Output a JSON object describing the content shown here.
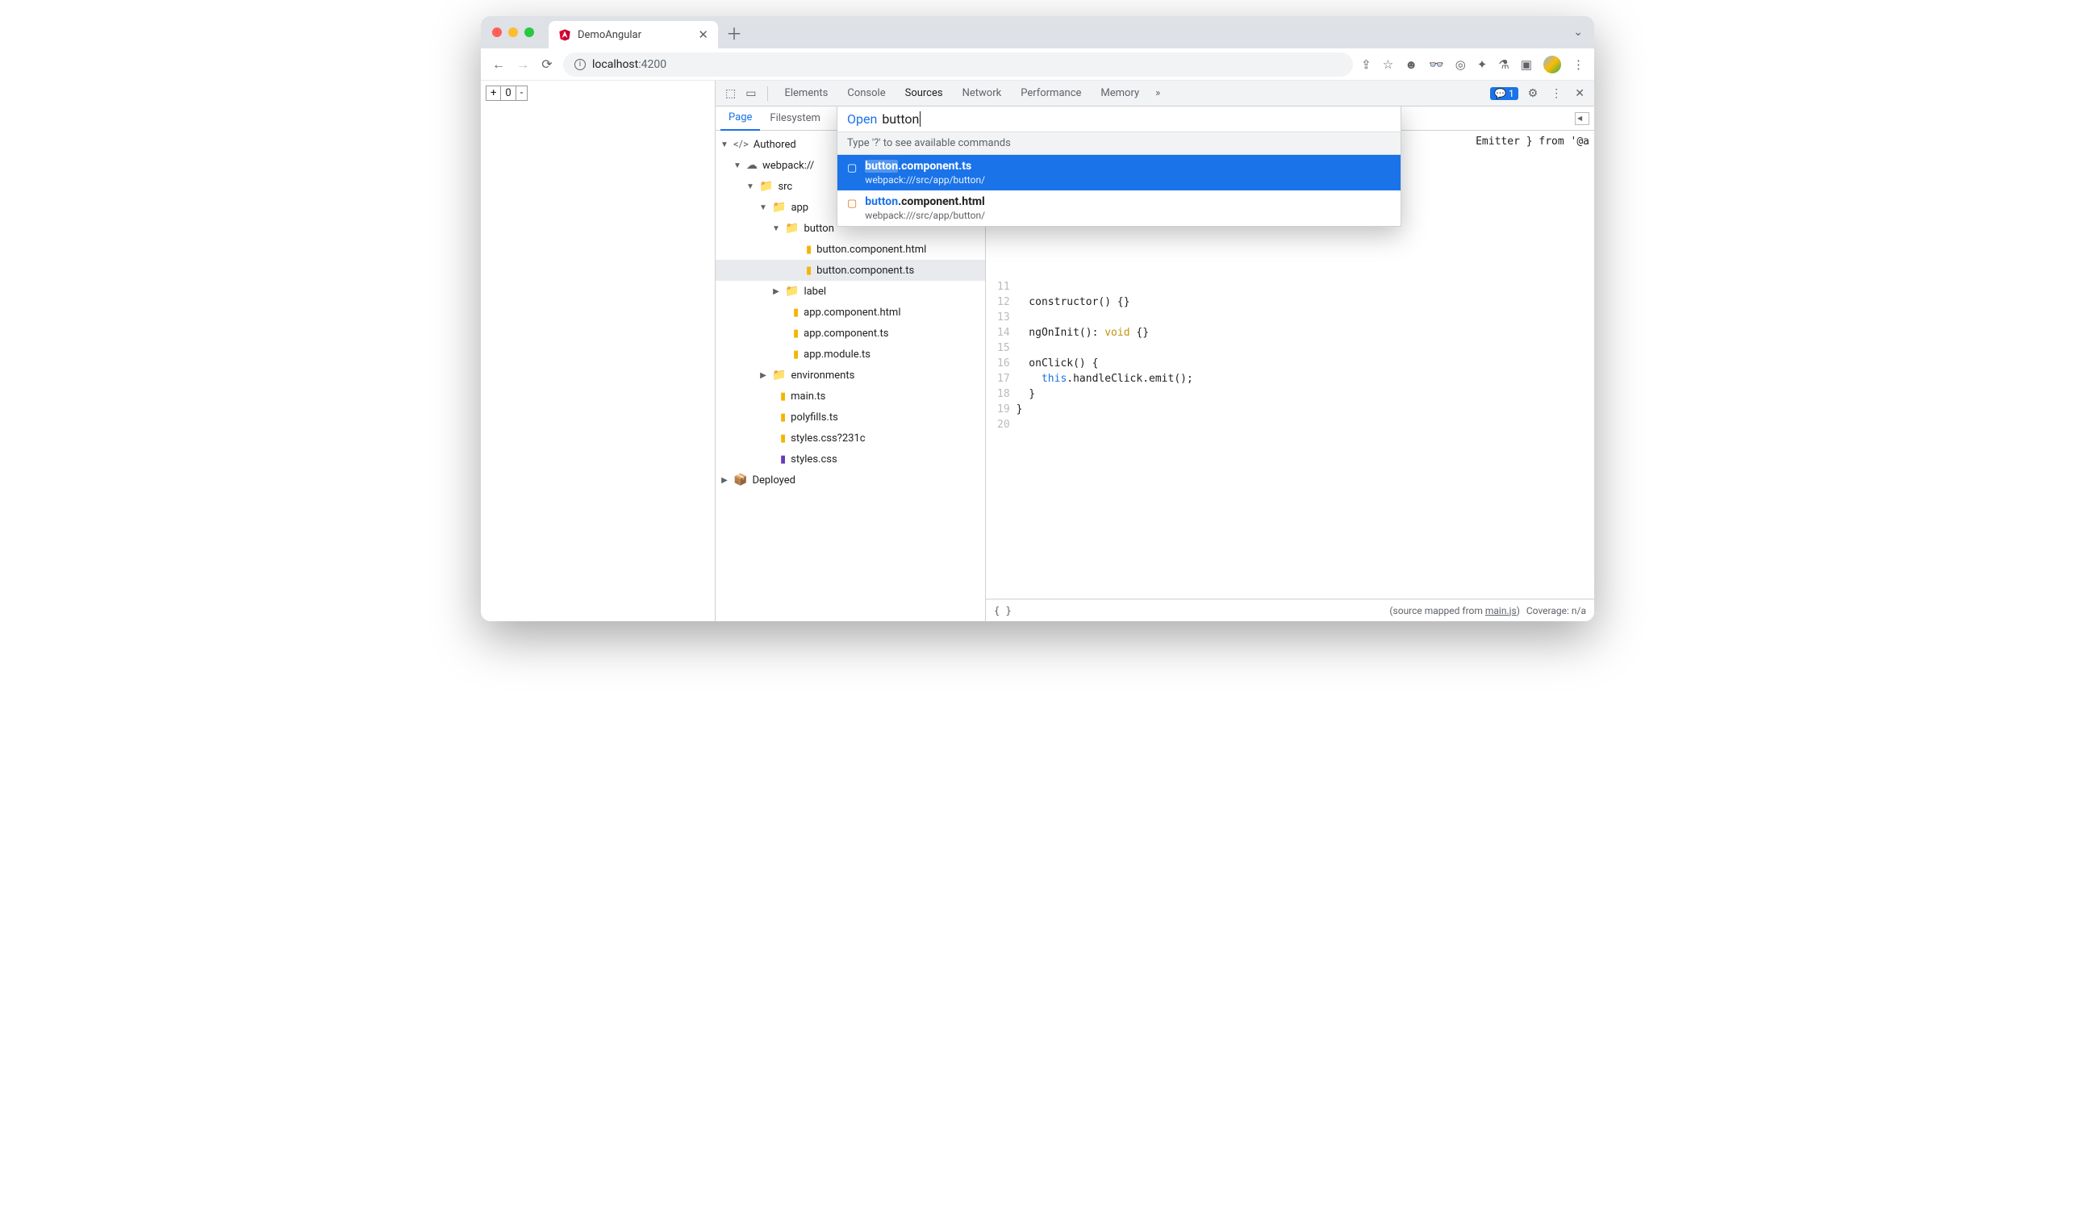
{
  "tab": {
    "title": "DemoAngular"
  },
  "url": {
    "host": "localhost",
    "port": ":4200"
  },
  "page_widgets": {
    "plus": "+",
    "zero": "0",
    "minus": "-"
  },
  "devtools": {
    "tabs": [
      "Elements",
      "Console",
      "Sources",
      "Network",
      "Performance",
      "Memory"
    ],
    "active": "Sources",
    "badge": "1"
  },
  "sources": {
    "subtabs": {
      "page": "Page",
      "filesystem": "Filesystem"
    },
    "tree": {
      "authored": "Authored",
      "webpack": "webpack://",
      "src": "src",
      "app": "app",
      "button_folder": "button",
      "button_html": "button.component.html",
      "button_ts": "button.component.ts",
      "label": "label",
      "app_html": "app.component.html",
      "app_ts": "app.component.ts",
      "app_module": "app.module.ts",
      "env": "environments",
      "main": "main.ts",
      "polyfills": "polyfills.ts",
      "styles_q": "styles.css?231c",
      "styles": "styles.css",
      "deployed": "Deployed"
    }
  },
  "quickopen": {
    "label": "Open",
    "query": "button",
    "hint": "Type '?' to see available commands",
    "results": [
      {
        "prefix": "button",
        "rest": ".component.ts",
        "path": "webpack:///src/app/button/"
      },
      {
        "prefix": "button",
        "rest": ".component.html",
        "path": "webpack:///src/app/button/"
      }
    ]
  },
  "code": {
    "first_visible_line": 11,
    "partial_top": "Emitter } from '@a",
    "lines": {
      "l11": "",
      "l12": "  constructor() {}",
      "l13": "",
      "l14": "  ngOnInit(): void {}",
      "l15": "",
      "l16": "  onClick() {",
      "l17": "    this.handleClick.emit();",
      "l18": "  }",
      "l19": "}",
      "l20": ""
    }
  },
  "status": {
    "mapped_prefix": "(source mapped from ",
    "mapped_link": "main.js",
    "mapped_suffix": ")",
    "coverage": "Coverage: n/a"
  }
}
